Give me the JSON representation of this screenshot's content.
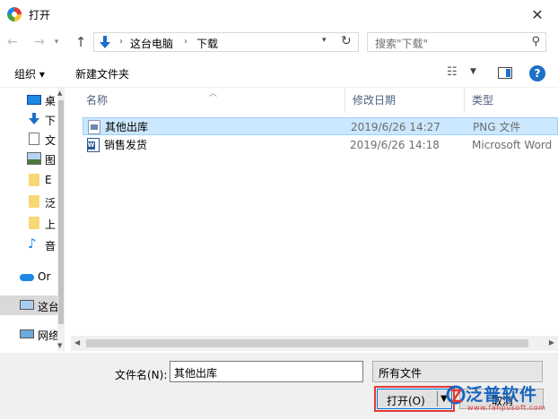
{
  "window": {
    "title": "打开",
    "close_glyph": "✕"
  },
  "navigation": {
    "back_glyph": "←",
    "forward_glyph": "→",
    "recent_glyph": "▾",
    "up_glyph": "↑",
    "breadcrumb": [
      "这台电脑",
      "下载"
    ],
    "separator": "›",
    "refresh_glyph": "↻",
    "search_placeholder": "搜索\"下载\""
  },
  "toolbar": {
    "organize": "组织 ▾",
    "new_folder": "新建文件夹",
    "help": "?"
  },
  "sidebar": {
    "items": [
      {
        "label": "桌",
        "icon": "desktop-icon"
      },
      {
        "label": "下",
        "icon": "download-icon"
      },
      {
        "label": "文",
        "icon": "documents-icon"
      },
      {
        "label": "图",
        "icon": "pictures-icon"
      },
      {
        "label": "E",
        "icon": "folder-icon"
      },
      {
        "label": "泛",
        "icon": "folder-icon"
      },
      {
        "label": "上",
        "icon": "folder-icon"
      },
      {
        "label": "音",
        "icon": "music-icon"
      },
      {
        "label": "Or",
        "icon": "onedrive-icon"
      },
      {
        "label": "这台",
        "icon": "computer-icon"
      },
      {
        "label": "网络",
        "icon": "network-icon"
      }
    ]
  },
  "file_list": {
    "columns": {
      "name": "名称",
      "date": "修改日期",
      "type": "类型"
    },
    "rows": [
      {
        "name": "其他出库",
        "date": "2019/6/26 14:27",
        "type": "PNG 文件",
        "icon": "png-file-icon"
      },
      {
        "name": "销售发货",
        "date": "2019/6/26 14:18",
        "type": "Microsoft Word",
        "icon": "word-file-icon"
      }
    ]
  },
  "footer": {
    "filename_label": "文件名(N):",
    "filename_value": "其他出库",
    "filetype_value": "所有文件",
    "open_label": "打开(O)",
    "cancel_label": "取消"
  },
  "watermark": {
    "brand": "泛普软件",
    "url": "www.fanpusoft.com"
  },
  "colors": {
    "accent": "#0078d7",
    "highlight": "#e53935",
    "selection": "#cce8ff"
  }
}
